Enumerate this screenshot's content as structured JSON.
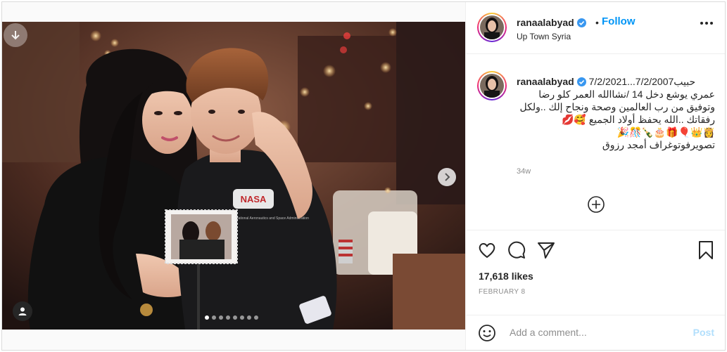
{
  "header": {
    "username": "ranaalabyad",
    "follow_label": "Follow",
    "bullet": "•",
    "location": "Up Town Syria"
  },
  "caption": {
    "username": "ranaalabyad",
    "line1": "حبيب7/2/2007...7/2/2021",
    "line2": "عمري يوشع دخل 14 /نشاالله العمر كلو رضا وتوفيق من رب العالمين وصحة ونجاح إلك ..ولكل رفقاتك ..الله يحفظ أولاد الجميع 🥰💋",
    "emojis": "🎉🎊🍾🎂🎁🎈👑👸",
    "credit": "تصويرفوتوغراف أمجد رزوق",
    "time": "34w"
  },
  "actions": {
    "likes": "17,618 likes",
    "date": "FEBRUARY 8"
  },
  "comment": {
    "placeholder": "Add a comment...",
    "post_label": "Post"
  },
  "carousel": {
    "slide_count": 8,
    "active_index": 0
  },
  "photo": {
    "card_caption": "NASA",
    "card_subtext": "National Aeronautics and Space Administration"
  },
  "colors": {
    "accent": "#0095f6",
    "post_disabled": "#b2dffc",
    "secondary_text": "#8e8e8e"
  }
}
